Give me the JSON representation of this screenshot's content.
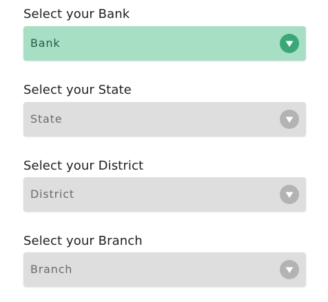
{
  "form": {
    "fields": [
      {
        "label": "Select your Bank",
        "value": "Bank",
        "state": "enabled",
        "icon": "chevron-down-icon"
      },
      {
        "label": "Select your State",
        "value": "State",
        "state": "disabled",
        "icon": "chevron-down-icon"
      },
      {
        "label": "Select your District",
        "value": "District",
        "state": "disabled",
        "icon": "chevron-down-icon"
      },
      {
        "label": "Select your Branch",
        "value": "Branch",
        "state": "disabled",
        "icon": "chevron-down-icon"
      }
    ]
  },
  "colors": {
    "enabled_bg": "#a6dfc4",
    "enabled_icon": "#3aa876",
    "disabled_bg": "#dedede",
    "disabled_icon": "#b3b3b3"
  }
}
